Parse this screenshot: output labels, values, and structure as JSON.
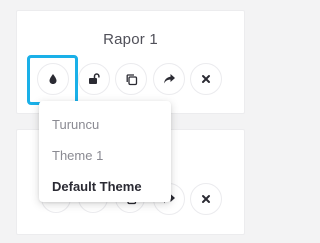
{
  "colors": {
    "highlight": "#1ab0e8",
    "icon": "#2b2b33",
    "muted_text": "#8a8a92",
    "title_text": "#505059",
    "selected_text": "#2a2a33"
  },
  "cards": [
    {
      "title": "Rapor 1",
      "actions": [
        {
          "icon": "drop-icon",
          "label": "theme"
        },
        {
          "icon": "unlock-icon",
          "label": "unlock"
        },
        {
          "icon": "copy-icon",
          "label": "copy"
        },
        {
          "icon": "share-icon",
          "label": "share"
        },
        {
          "icon": "close-icon",
          "label": "delete"
        }
      ]
    },
    {
      "title": "",
      "actions": [
        {
          "icon": "share-icon",
          "label": "share"
        },
        {
          "icon": "close-icon",
          "label": "delete"
        }
      ]
    }
  ],
  "theme_menu": {
    "items": [
      "Turuncu",
      "Theme 1",
      "Default Theme"
    ],
    "selected": "Default Theme"
  }
}
